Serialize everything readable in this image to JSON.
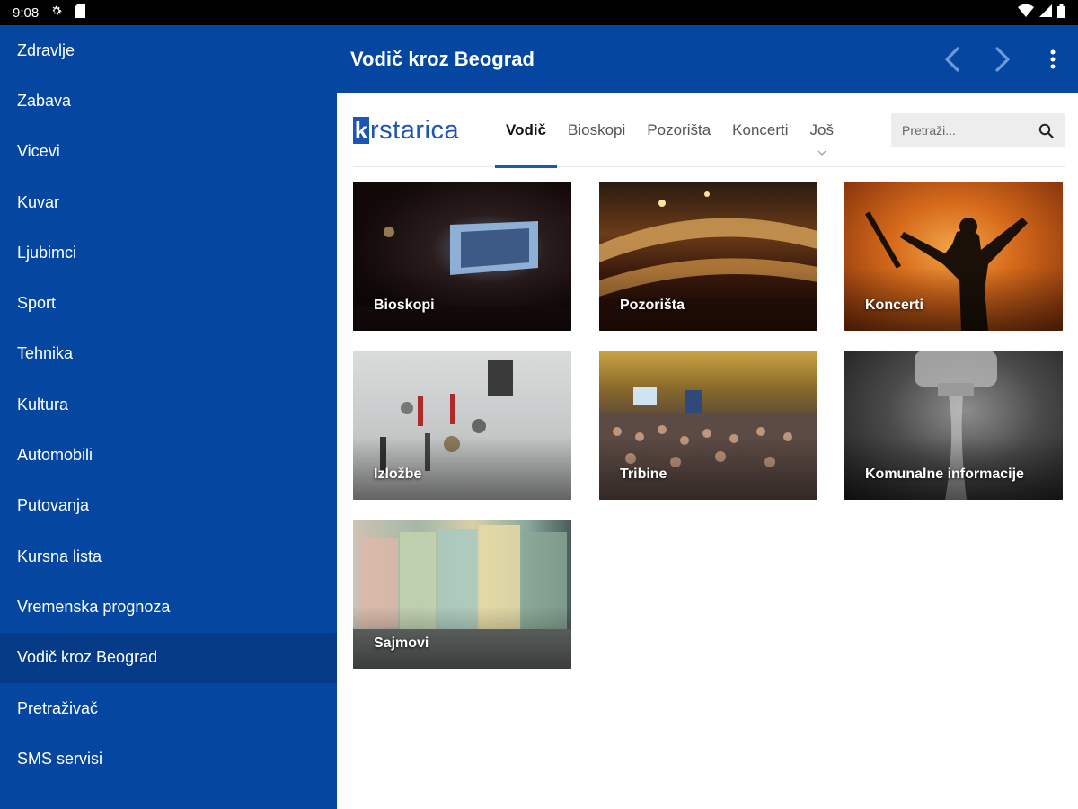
{
  "status_bar": {
    "time": "9:08"
  },
  "drawer": {
    "items": [
      {
        "label": "Zdravlje"
      },
      {
        "label": "Zabava"
      },
      {
        "label": "Vicevi"
      },
      {
        "label": "Kuvar"
      },
      {
        "label": "Ljubimci"
      },
      {
        "label": "Sport"
      },
      {
        "label": "Tehnika"
      },
      {
        "label": "Kultura"
      },
      {
        "label": "Automobili"
      },
      {
        "label": "Putovanja"
      },
      {
        "label": "Kursna lista"
      },
      {
        "label": "Vremenska prognoza"
      },
      {
        "label": "Vodič kroz Beograd",
        "active": true
      },
      {
        "label": "Pretraživač"
      },
      {
        "label": "SMS servisi"
      }
    ]
  },
  "appbar": {
    "title": "Vodič kroz Beograd",
    "icons": [
      "back-arrow-icon",
      "forward-arrow-icon",
      "more-vert-icon"
    ]
  },
  "site": {
    "logo_letter": "k",
    "logo_text": "rstarica",
    "nav": {
      "tabs": [
        {
          "label": "Vodič",
          "active": true
        },
        {
          "label": "Bioskopi"
        },
        {
          "label": "Pozorišta"
        },
        {
          "label": "Koncerti"
        },
        {
          "label": "Još"
        }
      ]
    },
    "search": {
      "placeholder": "Pretraži..."
    }
  },
  "cards": [
    {
      "label": "Bioskopi"
    },
    {
      "label": "Pozorišta"
    },
    {
      "label": "Koncerti"
    },
    {
      "label": "Izložbe"
    },
    {
      "label": "Tribine"
    },
    {
      "label": "Komunalne informacije"
    },
    {
      "label": "Sajmovi"
    }
  ],
  "colors": {
    "primary": "#0547a0",
    "drawer_active": "#053b86",
    "accent": "#1b56b6"
  }
}
